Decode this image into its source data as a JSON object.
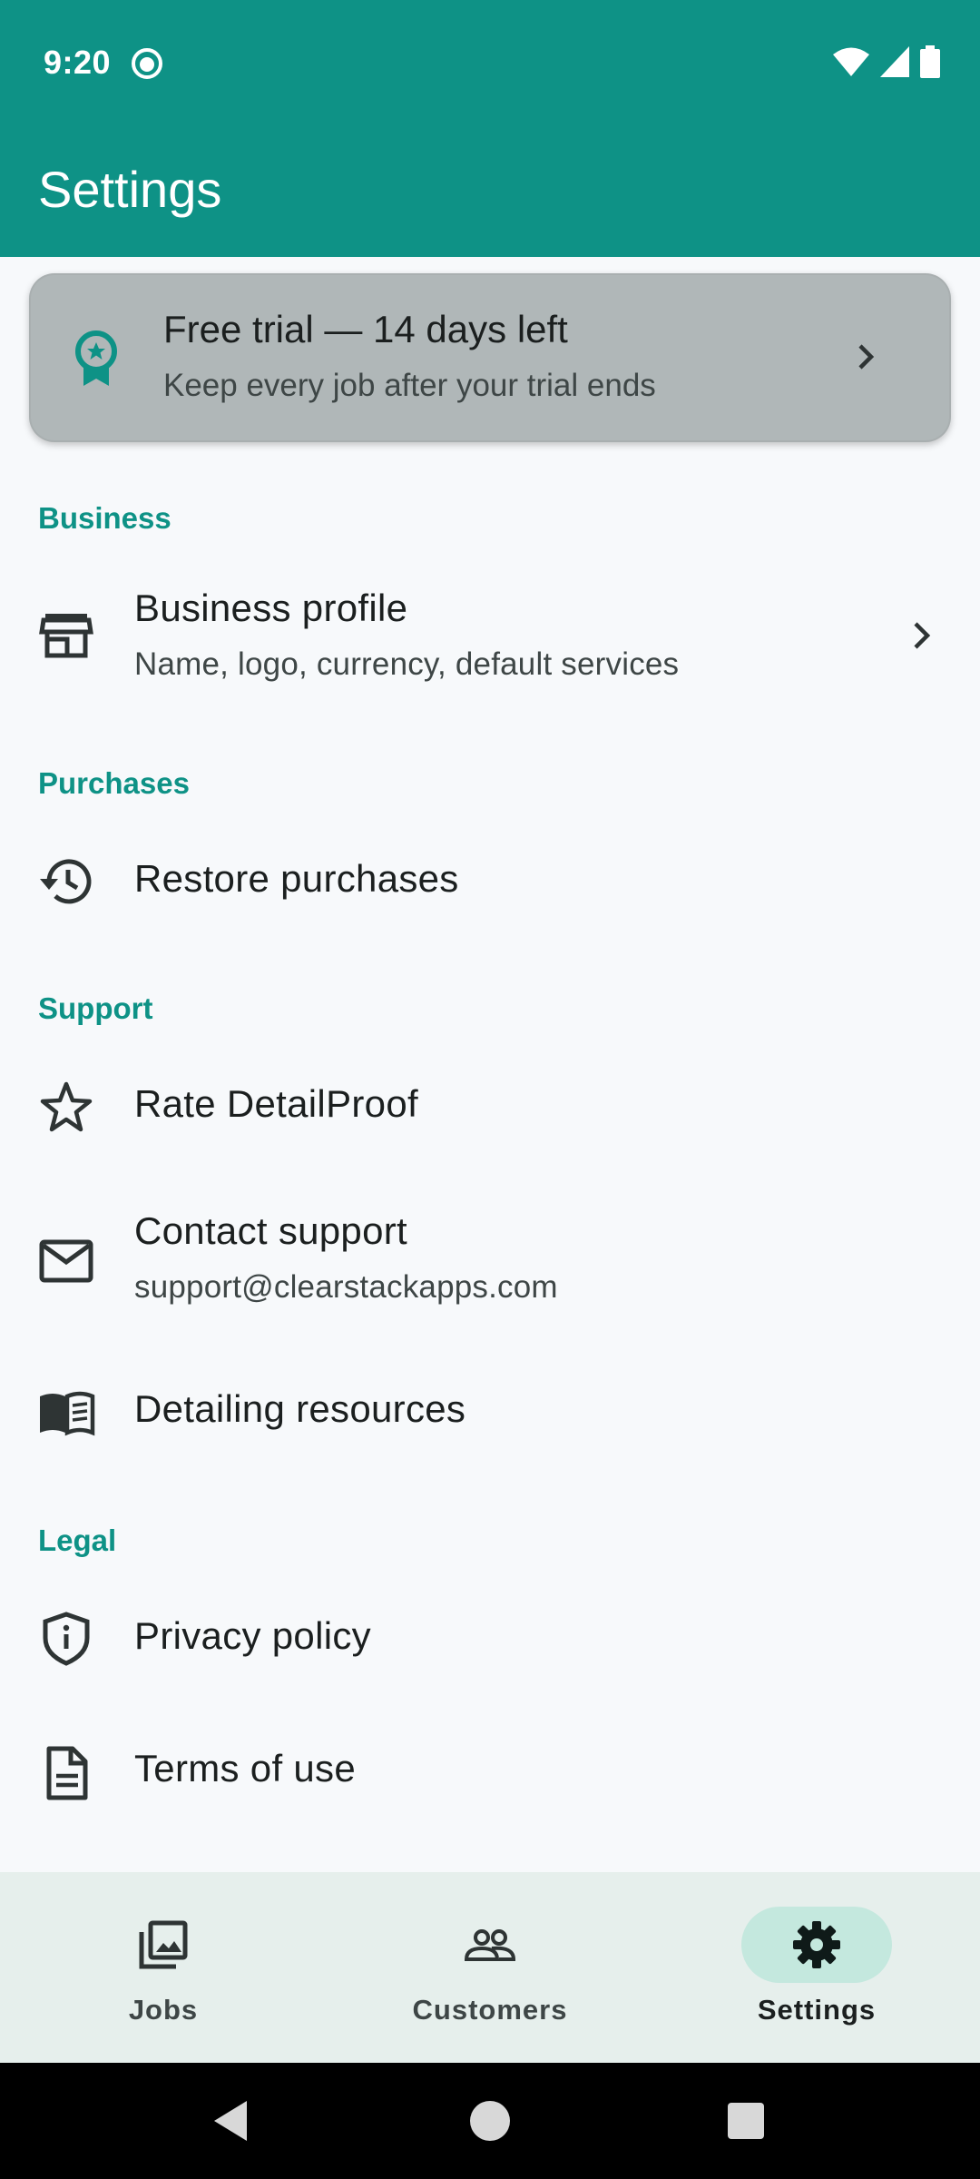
{
  "status_bar": {
    "time": "9:20"
  },
  "header": {
    "title": "Settings"
  },
  "trial_banner": {
    "title": "Free trial — 14 days left",
    "subtitle": "Keep every job after your trial ends"
  },
  "sections": {
    "business": {
      "header": "Business",
      "business_profile": {
        "title": "Business profile",
        "subtitle": "Name, logo, currency, default services"
      }
    },
    "purchases": {
      "header": "Purchases",
      "restore": {
        "title": "Restore purchases"
      }
    },
    "support": {
      "header": "Support",
      "rate": {
        "title": "Rate DetailProof"
      },
      "contact": {
        "title": "Contact support",
        "subtitle": "support@clearstackapps.com"
      },
      "resources": {
        "title": "Detailing resources"
      }
    },
    "legal": {
      "header": "Legal",
      "privacy": {
        "title": "Privacy policy"
      },
      "terms": {
        "title": "Terms of use"
      }
    }
  },
  "bottom_nav": {
    "items": [
      {
        "label": "Jobs",
        "icon": "photo-library-icon",
        "active": false
      },
      {
        "label": "Customers",
        "icon": "people-icon",
        "active": false
      },
      {
        "label": "Settings",
        "icon": "gear-icon",
        "active": true
      }
    ]
  },
  "colors": {
    "primary": "#0e9286",
    "background": "#f7f9fb",
    "trial_card": "#b0b7b8",
    "nav_background": "#e6efec",
    "nav_active_pill": "#c4e8de"
  }
}
